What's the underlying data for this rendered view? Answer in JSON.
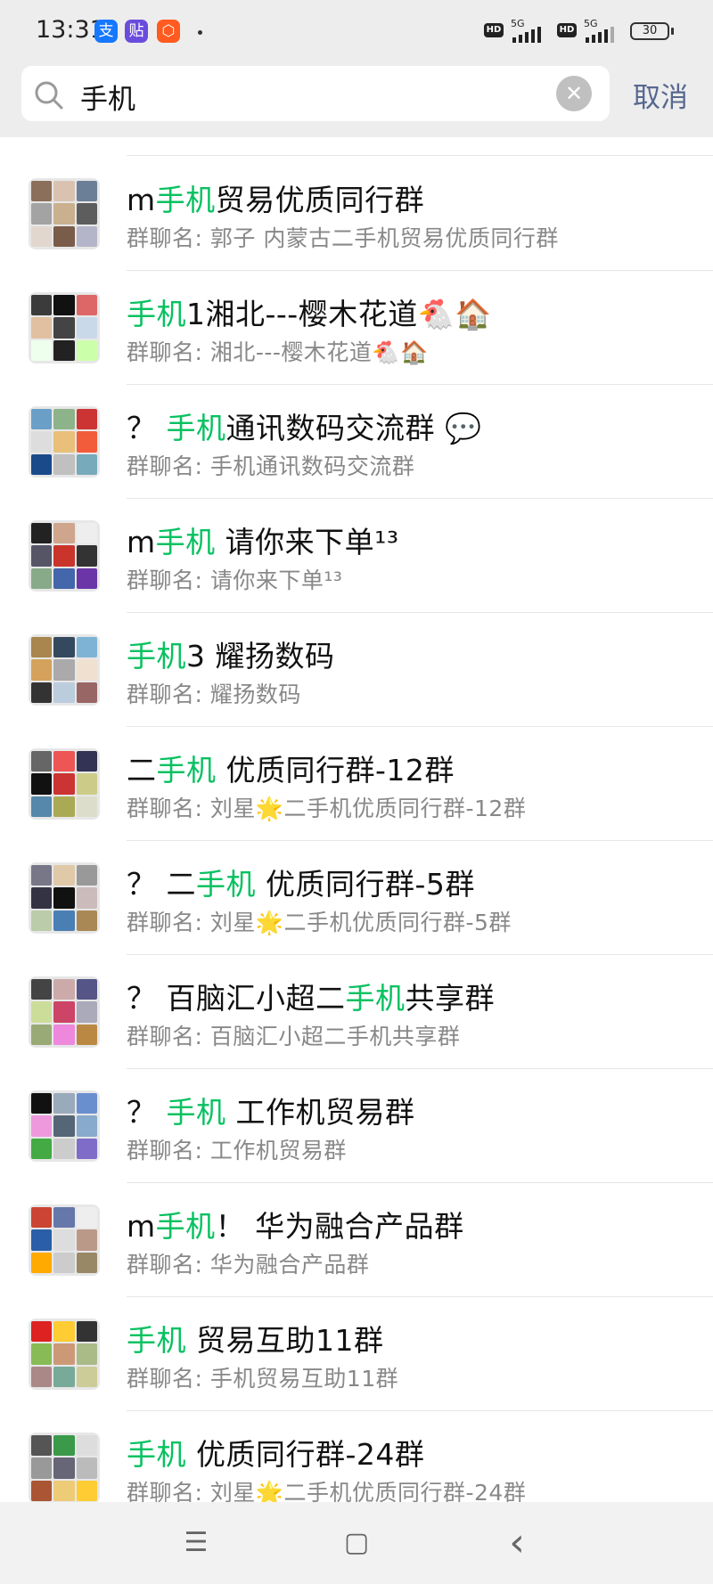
{
  "status": {
    "time": "13:31",
    "apps": [
      {
        "icon": "alipay-icon",
        "glyph": "支",
        "color": "#1677ff"
      },
      {
        "icon": "tieba-icon",
        "glyph": "贴",
        "color": "#6a4cdc"
      },
      {
        "icon": "taobao-icon",
        "glyph": "⬡",
        "color": "#ff5a1f"
      }
    ],
    "network": "5G",
    "hd": "HD",
    "battery": "30"
  },
  "search": {
    "query": "手机",
    "cancel_label": "取消"
  },
  "results": [
    {
      "pre": "m",
      "hl": "手机",
      "post": "贸易优质同行群",
      "sub": "群聊名: 郭子 内蒙古二手机贸易优质同行群"
    },
    {
      "pre": "",
      "hl": "手机",
      "post": "1湘北---樱木花道🐔🏠",
      "sub": "群聊名: 湘北---樱木花道🐔🏠"
    },
    {
      "pre": "？ ",
      "hl": "手机",
      "post": "通讯数码交流群 💬",
      "sub": "群聊名: 手机通讯数码交流群"
    },
    {
      "pre": "m",
      "hl": "手机",
      "post": " 请你来下单¹³",
      "sub": "群聊名: 请你来下单¹³"
    },
    {
      "pre": "",
      "hl": "手机",
      "post": "3  耀扬数码",
      "sub": "群聊名: 耀扬数码"
    },
    {
      "pre": "二",
      "hl": "手机",
      "post": "  优质同行群-12群",
      "sub": "群聊名: 刘星🌟二手机优质同行群-12群"
    },
    {
      "pre": "？ 二",
      "hl": "手机",
      "post": " 优质同行群-5群",
      "sub": "群聊名: 刘星🌟二手机优质同行群-5群"
    },
    {
      "pre": "？  百脑汇小超二",
      "hl": "手机",
      "post": "共享群",
      "sub": "群聊名: 百脑汇小超二手机共享群"
    },
    {
      "pre": "？ ",
      "hl": "手机",
      "post": "   工作机贸易群",
      "sub": "群聊名: 工作机贸易群"
    },
    {
      "pre": "m",
      "hl": "手机",
      "post": "！ 华为融合产品群",
      "sub": "群聊名: 华为融合产品群"
    },
    {
      "pre": "",
      "hl": "手机",
      "post": "   贸易互助11群",
      "sub": "群聊名: 手机贸易互助11群"
    },
    {
      "pre": "",
      "hl": "手机",
      "post": "  优质同行群-24群",
      "sub": "群聊名: 刘星🌟二手机优质同行群-24群"
    }
  ],
  "nav": {
    "menu": "☰",
    "home": "▢",
    "back": "‹"
  },
  "colors": {
    "highlight": "#07c160",
    "cancel": "#57688f",
    "header_bg": "#ededed"
  }
}
